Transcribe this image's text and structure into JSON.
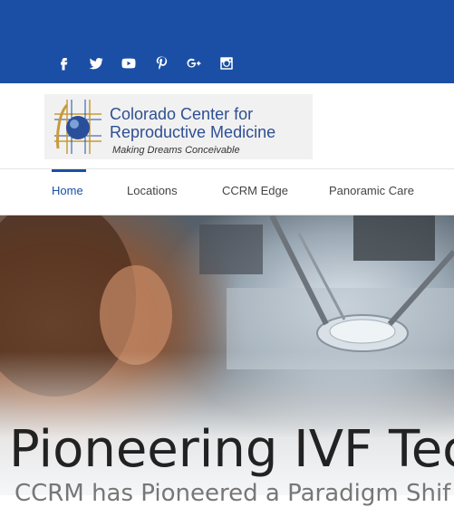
{
  "social": {
    "icons": [
      "facebook-icon",
      "twitter-icon",
      "youtube-icon",
      "pinterest-icon",
      "google-plus-icon",
      "instagram-icon"
    ]
  },
  "logo": {
    "line1": "Colorado Center for",
    "line2": "Reproductive Medicine",
    "tagline": "Making Dreams Conceivable"
  },
  "nav": {
    "items": [
      {
        "label": "Home",
        "active": true
      },
      {
        "label": "Locations",
        "active": false
      },
      {
        "label": "CCRM Edge",
        "active": false
      },
      {
        "label": "Panoramic Care",
        "active": false
      }
    ]
  },
  "hero": {
    "title": "Pioneering IVF Tec",
    "subtitle": "CCRM has Pioneered a Paradigm Shif"
  },
  "colors": {
    "brand": "#1a4fa5",
    "logo_text": "#2d4f93"
  }
}
